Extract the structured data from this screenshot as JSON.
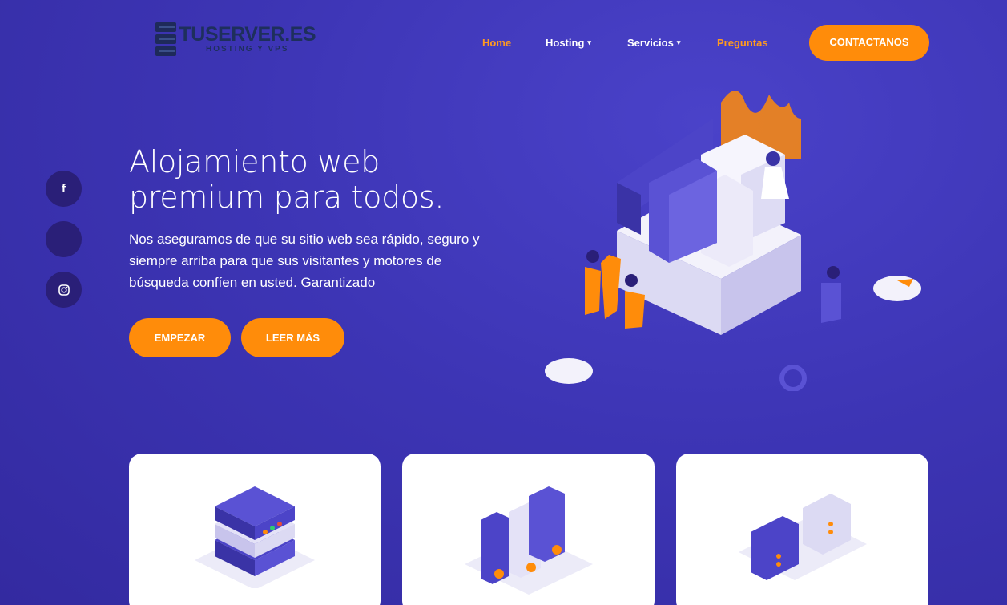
{
  "brand": {
    "name": "TUSERVER.ES",
    "tagline": "HOSTING Y VPS"
  },
  "nav": {
    "home": "Home",
    "hosting": "Hosting",
    "servicios": "Servicios",
    "preguntas": "Preguntas",
    "caret": "▾"
  },
  "header": {
    "contact_label": "CONTACTANOS"
  },
  "social": {
    "facebook_glyph": "f",
    "instagram_glyph": "◎"
  },
  "hero": {
    "title_line1": "Alojamiento web",
    "title_line2": "premium para todos.",
    "description": "Nos aseguramos de que su sitio web sea rápido, seguro y siempre arriba para que sus visitantes y motores de búsqueda confíen en usted. Garantizado",
    "start_label": "EMPEZAR",
    "more_label": "LEER MÁS"
  },
  "colors": {
    "accent": "#ff8c0a",
    "background": "#3d35b5",
    "icon_dark": "#2a1f78",
    "brand_text": "#1e2f5c"
  },
  "icons": [
    "facebook-icon",
    "social-icon",
    "instagram-icon",
    "server-stack-icon",
    "server-racks-icon",
    "server-cluster-icon"
  ]
}
